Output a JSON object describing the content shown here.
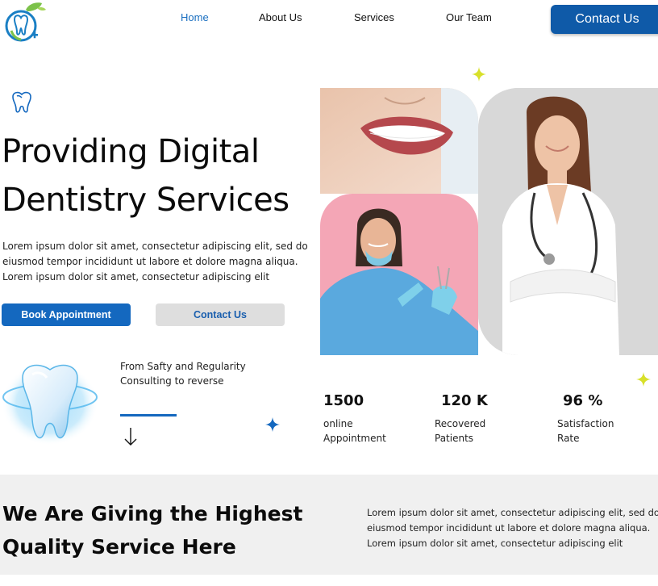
{
  "nav": {
    "items": [
      {
        "label": "Home",
        "active": true
      },
      {
        "label": "About Us",
        "active": false
      },
      {
        "label": "Services",
        "active": false
      },
      {
        "label": "Our Team",
        "active": false
      }
    ],
    "contact_button": "Contact Us"
  },
  "hero": {
    "title_line1": "Providing Digital",
    "title_line2": "Dentistry Services",
    "description": "Lorem ipsum dolor sit amet, consectetur adipiscing elit, sed do eiusmod tempor incididunt ut labore et dolore magna aliqua. Lorem ipsum dolor sit amet, consectetur adipiscing elit",
    "book_button": "Book Appointment",
    "contact_button": "Contact Us"
  },
  "consult": {
    "text": "From Safty and Regularity Consulting to reverse"
  },
  "stats": [
    {
      "value": "1500",
      "label": "online Appointment"
    },
    {
      "value": "120 K",
      "label": "Recovered Patients"
    },
    {
      "value": "96 %",
      "label": "Satisfaction Rate"
    }
  ],
  "section2": {
    "title_line1": "We Are Giving the Highest",
    "title_line2": "Quality Service Here",
    "description": "Lorem ipsum dolor sit amet, consectetur adipiscing elit, sed do eiusmod tempor incididunt ut labore et dolore magna aliqua. Lorem ipsum dolor sit amet, consectetur adipiscing elit"
  },
  "colors": {
    "primary_blue": "#1468bf",
    "dark_blue": "#0f5aa8",
    "accent_yellow": "#d8e02a",
    "gray_button": "#dedede",
    "section_bg": "#f0f0f0",
    "pink_bg": "#f4a6b6"
  },
  "icons": [
    "tooth-logo-icon",
    "tooth-outline-icon",
    "tooth-3d-icon",
    "arrow-down-icon",
    "sparkle-icon"
  ]
}
